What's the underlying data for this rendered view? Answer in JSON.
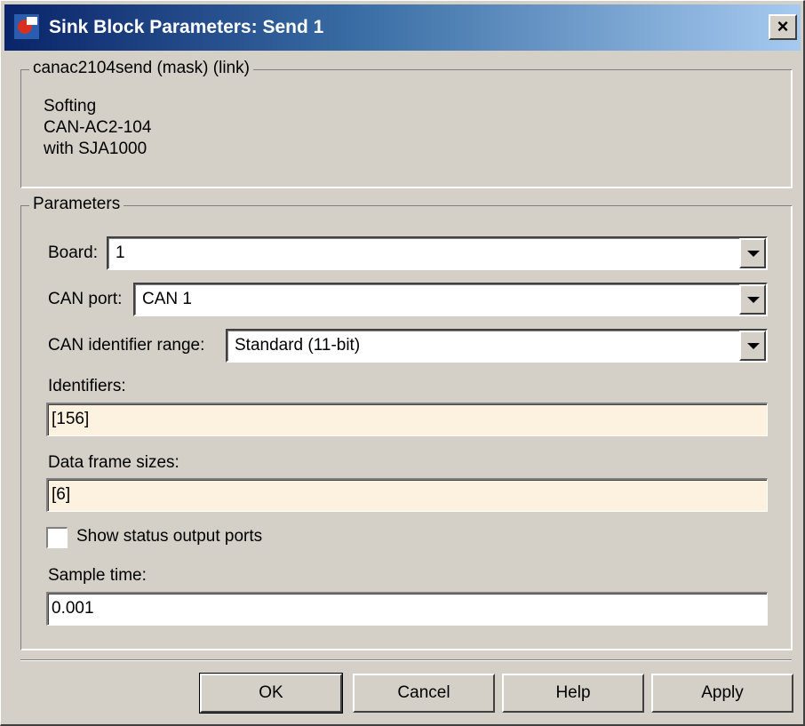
{
  "window": {
    "title": "Sink Block Parameters: Send 1",
    "close_glyph": "×"
  },
  "mask_group": {
    "legend": "canac2104send (mask) (link)",
    "description": [
      "Softing",
      "CAN-AC2-104",
      "with SJA1000"
    ]
  },
  "parameters": {
    "legend": "Parameters",
    "board": {
      "label": "Board:",
      "value": "1"
    },
    "can_port": {
      "label": "CAN port:",
      "value": "CAN 1"
    },
    "id_range": {
      "label": "CAN identifier range:",
      "value": "Standard (11-bit)"
    },
    "identifiers": {
      "label": "Identifiers:",
      "value": "[156]"
    },
    "frame_sizes": {
      "label": "Data frame sizes:",
      "value": "[6]"
    },
    "status_ports": {
      "label": "Show status output ports",
      "checked": false
    },
    "sample_time": {
      "label": "Sample time:",
      "value": "0.001"
    }
  },
  "buttons": {
    "ok": "OK",
    "cancel": "Cancel",
    "help": "Help",
    "apply": "Apply"
  },
  "icons": {
    "app": "simulink-block-icon",
    "close": "close-icon",
    "dropdown": "chevron-down-icon"
  },
  "colors": {
    "title_start": "#0a246a",
    "title_end": "#a6caf0",
    "dialog_bg": "#d4d0c8",
    "edit_bg": "#fdf2e0"
  }
}
